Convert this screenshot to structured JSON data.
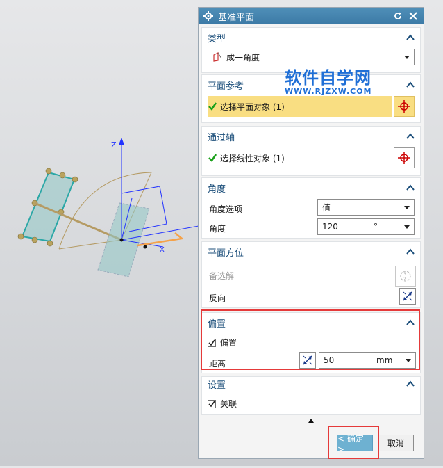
{
  "dialog": {
    "title": "基准平面",
    "sections": {
      "type": {
        "header": "类型",
        "selected": "成一角度"
      },
      "plane_ref": {
        "header": "平面参考",
        "select_label": "选择平面对象 (1)"
      },
      "through_axis": {
        "header": "通过轴",
        "select_label": "选择线性对象 (1)"
      },
      "angle": {
        "header": "角度",
        "option_label": "角度选项",
        "option_value": "值",
        "angle_label": "角度",
        "angle_value": "120",
        "angle_unit": "°"
      },
      "orientation": {
        "header": "平面方位",
        "alt_solution_label": "备选解",
        "reverse_label": "反向"
      },
      "offset": {
        "header": "偏置",
        "checkbox_label": "偏置",
        "checked": true,
        "distance_label": "距离",
        "distance_value": "50",
        "distance_unit": "mm"
      },
      "settings": {
        "header": "设置",
        "associative_label": "关联",
        "checked": true
      }
    },
    "buttons": {
      "ok": "< 确定 >",
      "cancel": "取消"
    }
  },
  "watermark": {
    "main": "软件自学网",
    "sub": "WWW.RJZXW.COM"
  },
  "axis_label": "Z",
  "colors": {
    "titlebar": "#3c7aa6",
    "accent": "#1b4e7a",
    "highlight": "#f9de82",
    "ok_button": "#6eb1d1",
    "annotation_red": "#e53a3a"
  },
  "icons": [
    "gear-icon",
    "reset-icon",
    "close-icon",
    "angle-plane-icon",
    "green-check-icon",
    "crosshair-icon",
    "alternate-solution-icon",
    "reverse-direction-icon",
    "expand-up-icon"
  ]
}
